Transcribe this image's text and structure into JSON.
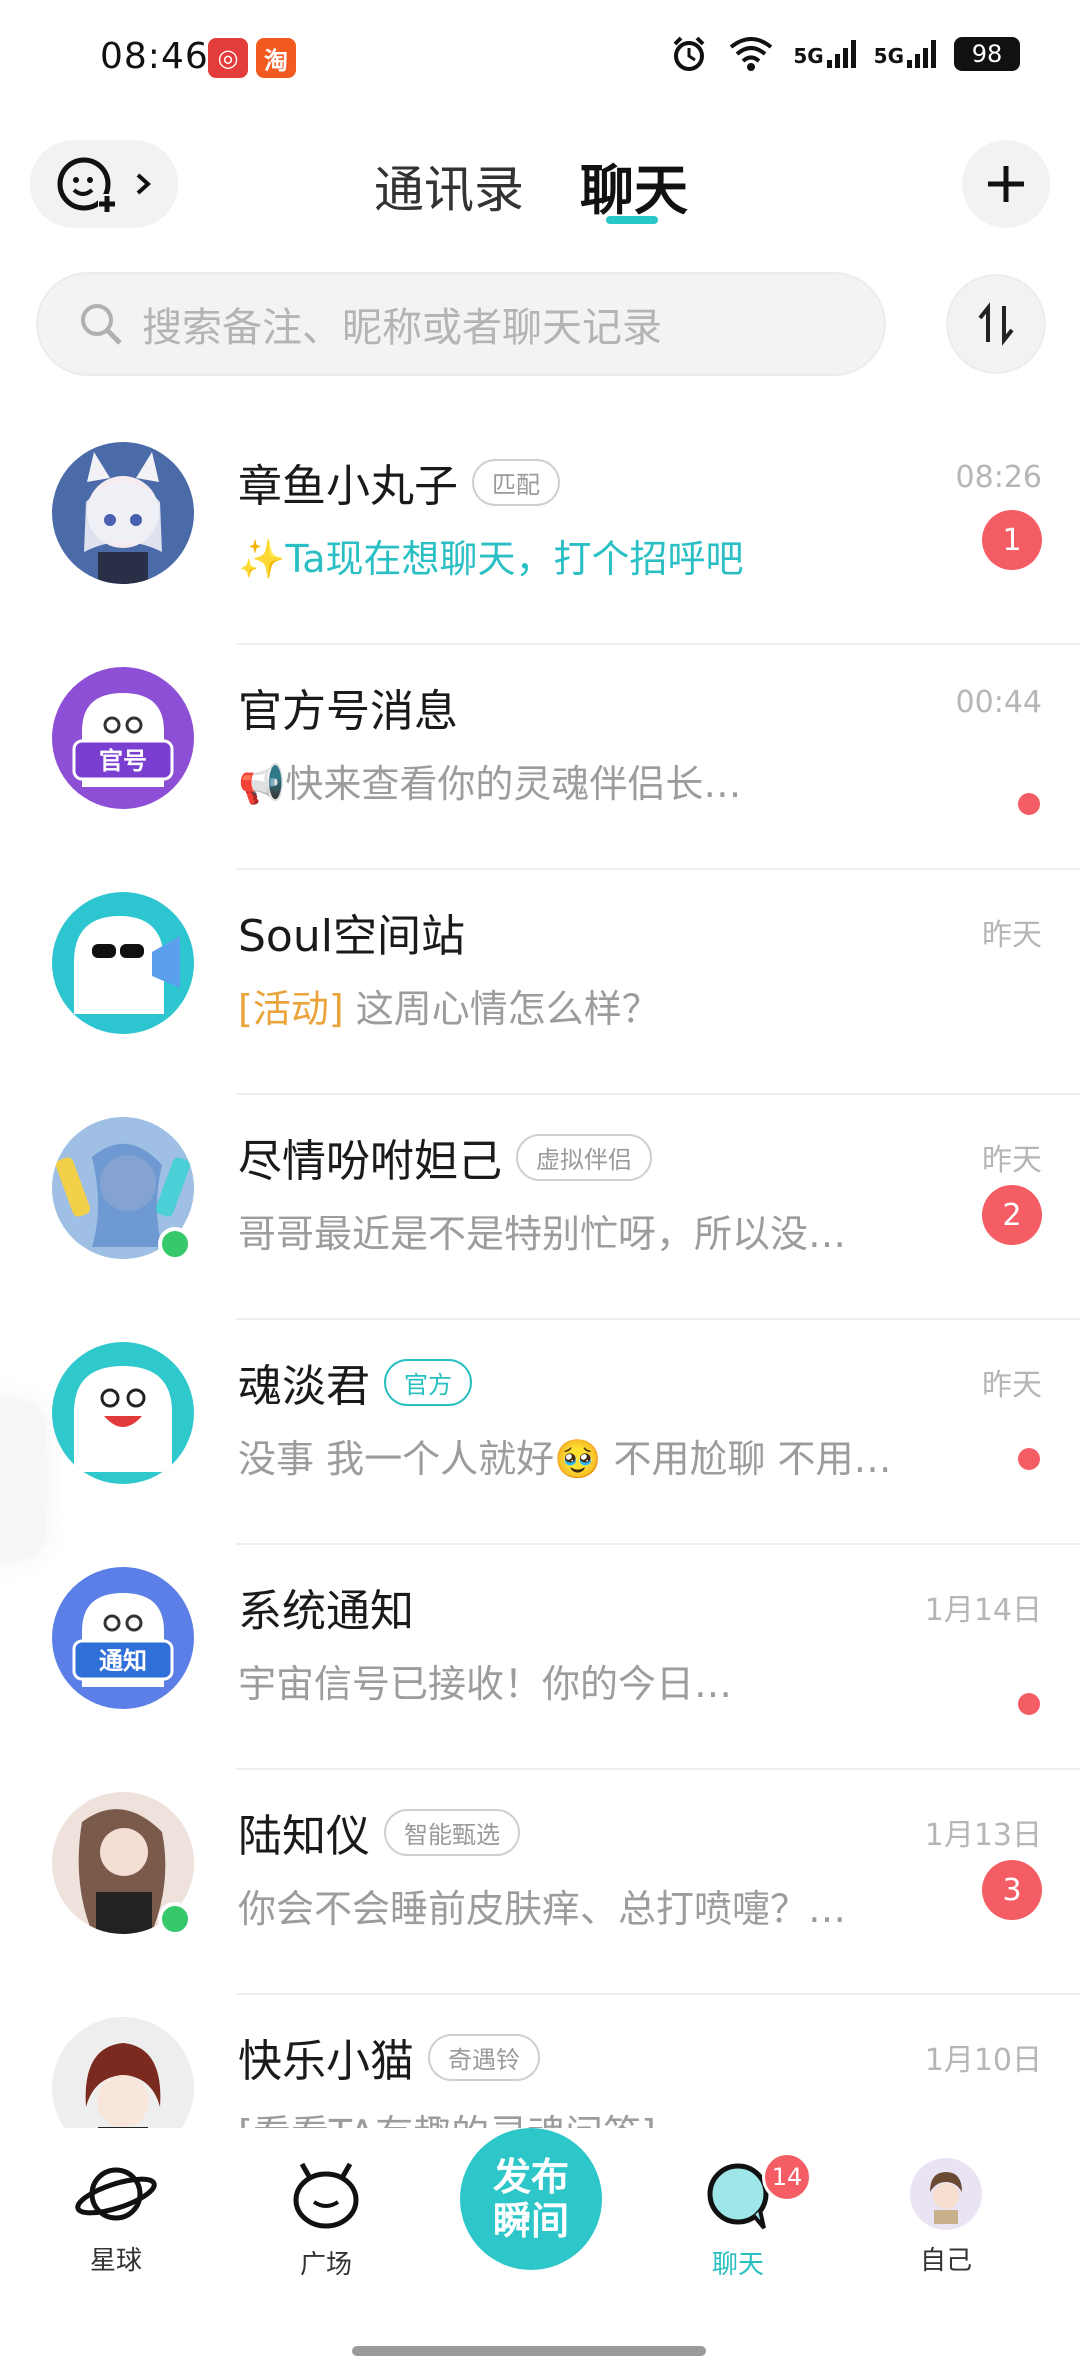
{
  "status_bar": {
    "time": "08:46",
    "battery": "98",
    "network1": "5G",
    "network2": "5G"
  },
  "header": {
    "tabs": [
      {
        "label": "通讯录"
      },
      {
        "label": "聊天"
      }
    ]
  },
  "search": {
    "placeholder": "搜索备注、昵称或者聊天记录"
  },
  "chats": [
    {
      "name": "章鱼小丸子",
      "tag": "匹配",
      "time": "08:26",
      "preview": "✨Ta现在想聊天，打个招呼吧",
      "badge": "1"
    },
    {
      "name": "官方号消息",
      "time": "00:44",
      "preview": "📢快来查看你的灵魂伴侣长…",
      "avatar_label": "官号"
    },
    {
      "name": "Soul空间站",
      "time": "昨天",
      "preview_prefix": "[活动]",
      "preview": "这周心情怎么样？"
    },
    {
      "name": "尽情吩咐妲己",
      "tag": "虚拟伴侣",
      "time": "昨天",
      "preview": "哥哥最近是不是特别忙呀，所以没…",
      "badge": "2"
    },
    {
      "name": "魂淡君",
      "tag": "官方",
      "time": "昨天",
      "preview": "没事 我一个人就好🥹 不用尬聊 不用…"
    },
    {
      "name": "系统通知",
      "time": "1月14日",
      "preview": "宇宙信号已接收！你的今日…",
      "avatar_label": "通知"
    },
    {
      "name": "陆知仪",
      "tag": "智能甄选",
      "time": "1月13日",
      "preview": "你会不会睡前皮肤痒、总打喷嚏？…",
      "badge": "3"
    },
    {
      "name": "快乐小猫",
      "tag": "奇遇铃",
      "time": "1月10日",
      "preview": "[看看TA有趣的灵魂问答]"
    }
  ],
  "bottom_nav": {
    "planet": "星球",
    "square": "广场",
    "publish": "发布瞬间",
    "chat": "聊天",
    "chat_badge": "14",
    "me": "自己"
  },
  "colors": {
    "accent": "#2ec7c9",
    "badge": "#f45d64",
    "online": "#35c96b"
  }
}
